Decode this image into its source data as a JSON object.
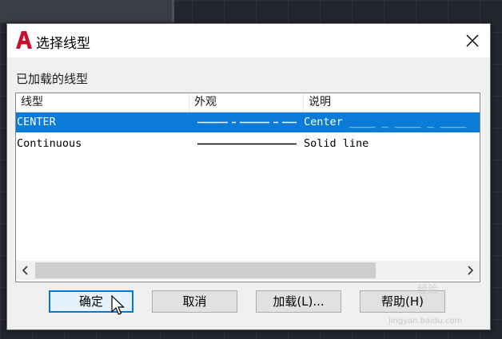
{
  "dialog": {
    "title": "选择线型",
    "group_label": "已加载的线型"
  },
  "columns": [
    "线型",
    "外观",
    "说明"
  ],
  "rows": [
    {
      "name": "CENTER",
      "description": "Center ____ _ ____ _ ____",
      "selected": true,
      "appearance": "center-dash"
    },
    {
      "name": "Continuous",
      "description": "Solid line",
      "selected": false,
      "appearance": "solid"
    }
  ],
  "buttons": {
    "ok": "确定",
    "cancel": "取消",
    "load": "加载(L)...",
    "help": "帮助(H)"
  },
  "watermark": {
    "text": "经验",
    "url": "jingyan.baidu.com"
  },
  "colors": {
    "selection": "#0a7bd7",
    "app_logo": "#c8102e"
  }
}
